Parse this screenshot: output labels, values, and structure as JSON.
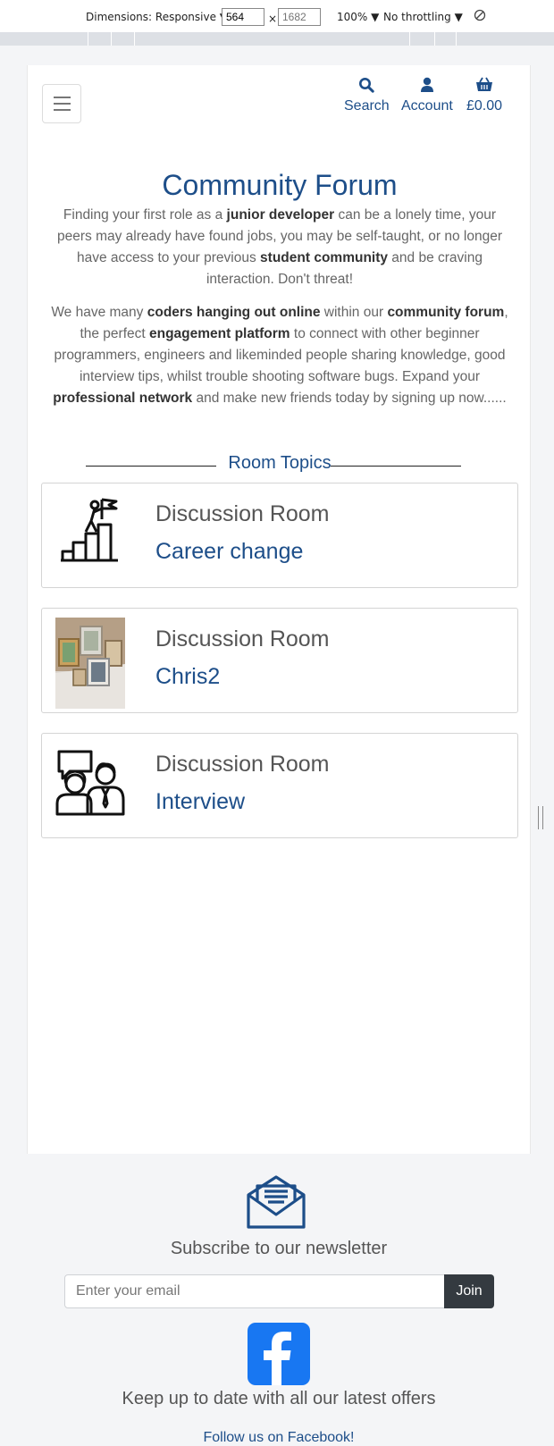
{
  "devtools": {
    "dimensions_label": "Dimensions: Responsive",
    "width_value": "564",
    "times": "×",
    "height_placeholder": "1682",
    "zoom": "100%",
    "throttling": "No throttling"
  },
  "header": {
    "search_label": "Search",
    "account_label": "Account",
    "basket_total": "£0.00"
  },
  "main": {
    "title": "Community Forum",
    "intro": {
      "p1_a": "Finding your first role as a ",
      "p1_b": "junior developer",
      "p1_c": " can be a lonely time, your peers may already have found jobs, you may be self-taught, or no longer have access to your previous ",
      "p1_d": "student community",
      "p1_e": " and be craving interaction. Don't threat!",
      "p2_a": "We have many ",
      "p2_b": "coders hanging out online",
      "p2_c": " within our ",
      "p2_d": "community forum",
      "p2_e": ", the perfect ",
      "p2_f": "engagement platform",
      "p2_g": " to connect with other beginner programmers, engineers and likeminded people sharing knowledge, good interview tips, whilst trouble shooting software bugs. Expand your ",
      "p2_h": "professional network",
      "p2_i": " and make new friends today by signing up now......"
    },
    "topics_heading": "Room Topics",
    "rooms": [
      {
        "kicker": "Discussion Room",
        "name": "Career change",
        "icon": "person-climbing-stairs-flag-icon"
      },
      {
        "kicker": "Discussion Room",
        "name": "Chris2",
        "icon": "photo-frames-thumbnail"
      },
      {
        "kicker": "Discussion Room",
        "name": "Interview",
        "icon": "interview-people-speech-icon"
      }
    ]
  },
  "footer": {
    "newsletter_title": "Subscribe to our newsletter",
    "email_placeholder": "Enter your email",
    "join_label": "Join",
    "offers_text": "Keep up to date with all our latest offers",
    "follow_text": "Follow us on Facebook!"
  },
  "colors": {
    "brand_blue": "#1d4e89",
    "facebook_blue": "#1877f2",
    "button_dark": "#343a40"
  }
}
